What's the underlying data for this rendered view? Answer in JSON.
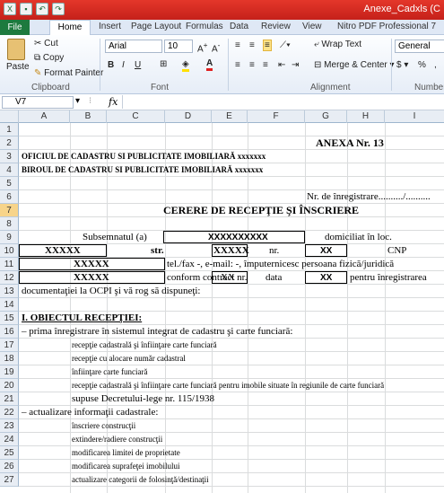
{
  "window": {
    "title": "Anexe_Cadxls (C"
  },
  "tabs": [
    "File",
    "Home",
    "Insert",
    "Page Layout",
    "Formulas",
    "Data",
    "Review",
    "View",
    "Nitro PDF Professional 7"
  ],
  "ribbon": {
    "paste": "Paste",
    "cut": "Cut",
    "copy": "Copy",
    "format_painter": "Format Painter",
    "font_name": "Arial",
    "font_size": "10",
    "wrap_text": "Wrap Text",
    "merge_center": "Merge & Center",
    "number_format": "General",
    "groups": [
      "Clipboard",
      "Font",
      "Alignment",
      "Number"
    ]
  },
  "formula_bar": {
    "name_box": "V7",
    "fx": "fx",
    "value": ""
  },
  "columns": [
    "A",
    "B",
    "C",
    "D",
    "E",
    "F",
    "G",
    "H",
    "I"
  ],
  "rows": [
    "1",
    "2",
    "3",
    "4",
    "5",
    "6",
    "7",
    "8",
    "9",
    "10",
    "11",
    "12",
    "13",
    "14",
    "15",
    "16",
    "17",
    "18",
    "19",
    "20",
    "21",
    "22",
    "23",
    "24",
    "25",
    "26",
    "27"
  ],
  "sheet": {
    "anexa": "ANEXA Nr. 13",
    "oficiul": "OFICIUL DE CADASTRU SI PUBLICITATE IMOBILIARĂ xxxxxxx",
    "biroul": "BIROUL DE CADASTRU SI PUBLICITATE IMOBILIARĂ xxxxxxx",
    "nr_inreg": "Nr. de înregistrare........../..........",
    "cerere": "CERERE DE RECEPŢIE ŞI ÎNSCRIERE",
    "subsemnatul": "Subsemnatul (a)",
    "x10": "XXXXXXXXXX",
    "domiciliat": "domiciliat în loc.",
    "x5a": "XXXXX",
    "str": "str.",
    "x5b": "XXXXX",
    "nr": "nr.",
    "xx1": "XX",
    "cnp": "CNP",
    "x5c": "XXXXX",
    "telfax": "tel./fax -, e-mail: -, împuternicesc persoana fizică/juridică",
    "x5d": "XXXXX",
    "conform": "conform contract nr.",
    "xx2": "XX",
    "data": "data",
    "xx3": "XX",
    "pentru": "pentru înregistrarea",
    "documentatiei": "documentaţiei la OCPI şi vă rog să dispuneţi:",
    "obiect": "I. OBIECTUL RECEPŢIEI:",
    "prima": "– prima înregistrare în sistemul integrat de cadastru şi carte funciară:",
    "r17": "recepţie cadastrală şi înfiinţare carte funciară",
    "r18": "recepţie cu alocare număr cadastral",
    "r19": "înfiinţare carte funciară",
    "r20": "recepţie cadastrală şi înfiinţare carte funciară pentru imobile situate în regiunile de carte funciară",
    "r21": "supuse Decretului-lege nr. 115/1938",
    "r22": "– actualizare informaţii cadastrale:",
    "r23": "înscriere construcţii",
    "r24": "extindere/radiere construcţii",
    "r25": "modificarea limitei de proprietate",
    "r26": "modificarea suprafeţei imobilului",
    "r27": "actualizare categorii de folosinţă/destinaţii"
  }
}
